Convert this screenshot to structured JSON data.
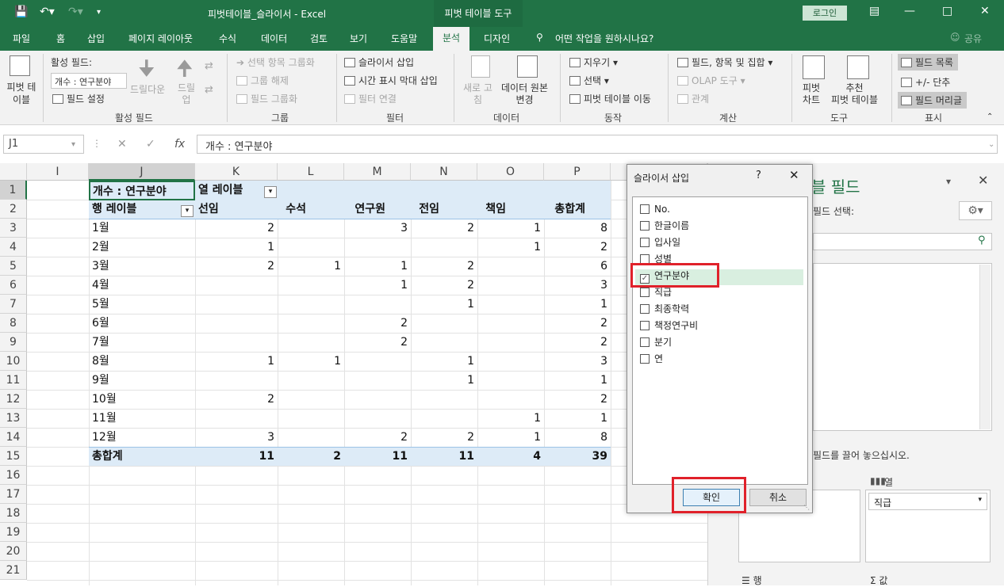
{
  "titlebar": {
    "title": "피벗테이블_슬라이서  -  Excel",
    "context_tab": "피벗 테이블 도구",
    "login": "로그인"
  },
  "tabs": {
    "file": "파일",
    "home": "홈",
    "insert": "삽입",
    "layout": "페이지 레이아웃",
    "formulas": "수식",
    "data": "데이터",
    "review": "검토",
    "view": "보기",
    "help": "도움말",
    "analyze": "분석",
    "design": "디자인",
    "tellme": "어떤 작업을 원하시나요?",
    "share": "공유"
  },
  "ribbon": {
    "pivot_table_btn": "피벗 테\n이블",
    "active_field_label": "활성 필드:",
    "active_field_value": "개수 : 연구분야",
    "field_settings": "필드 설정",
    "drill_down": "드릴다운",
    "drill_up": "드릴\n업",
    "group_active_field": "활성 필드",
    "group_selection": "선택 항목 그룹화",
    "ungroup": "그룹 해제",
    "group_field": "필드 그룹화",
    "group_group": "그룹",
    "insert_slicer": "슬라이서 삽입",
    "insert_timeline": "시간 표시 막대 삽입",
    "filter_connections": "필터 연결",
    "group_filter": "필터",
    "refresh": "새로 고\n침",
    "change_source": "데이터 원본\n변경",
    "group_data": "데이터",
    "clear": "지우기",
    "select": "선택",
    "move_pivot": "피벗 테이블 이동",
    "group_actions": "동작",
    "fields_items_sets": "필드, 항목 및 집합",
    "olap_tools": "OLAP 도구",
    "relationships": "관계",
    "group_calc": "계산",
    "pivot_chart": "피벗\n차트",
    "recommended": "추천\n피벗 테이블",
    "group_tools": "도구",
    "field_list": "필드 목록",
    "buttons": "+/- 단추",
    "field_headers": "필드 머리글",
    "group_show": "표시"
  },
  "formula_bar": {
    "name_box": "J1",
    "formula": "개수 : 연구분야"
  },
  "grid": {
    "columns": [
      "I",
      "J",
      "K",
      "L",
      "M",
      "N",
      "O",
      "P"
    ],
    "rows": [
      "1",
      "2",
      "3",
      "4",
      "5",
      "6",
      "7",
      "8",
      "9",
      "10",
      "11",
      "12",
      "13",
      "14",
      "15",
      "16",
      "17",
      "18",
      "19",
      "20",
      "21"
    ],
    "header_row1": {
      "j": "개수 : 연구분야",
      "k": "열 레이블"
    },
    "header_row2": {
      "j": "행 레이블",
      "k": "선임",
      "l": "수석",
      "m": "연구원",
      "n": "전임",
      "o": "책임",
      "p": "총합계"
    },
    "data_rows": [
      {
        "label": "1월",
        "k": "2",
        "l": "",
        "m": "3",
        "n": "2",
        "o": "1",
        "p": "8"
      },
      {
        "label": "2월",
        "k": "1",
        "l": "",
        "m": "",
        "n": "",
        "o": "1",
        "p": "2"
      },
      {
        "label": "3월",
        "k": "2",
        "l": "1",
        "m": "1",
        "n": "2",
        "o": "",
        "p": "6"
      },
      {
        "label": "4월",
        "k": "",
        "l": "",
        "m": "1",
        "n": "2",
        "o": "",
        "p": "3"
      },
      {
        "label": "5월",
        "k": "",
        "l": "",
        "m": "",
        "n": "1",
        "o": "",
        "p": "1"
      },
      {
        "label": "6월",
        "k": "",
        "l": "",
        "m": "2",
        "n": "",
        "o": "",
        "p": "2"
      },
      {
        "label": "7월",
        "k": "",
        "l": "",
        "m": "2",
        "n": "",
        "o": "",
        "p": "2"
      },
      {
        "label": "8월",
        "k": "1",
        "l": "1",
        "m": "",
        "n": "1",
        "o": "",
        "p": "3"
      },
      {
        "label": "9월",
        "k": "",
        "l": "",
        "m": "",
        "n": "1",
        "o": "",
        "p": "1"
      },
      {
        "label": "10월",
        "k": "2",
        "l": "",
        "m": "",
        "n": "",
        "o": "",
        "p": "2"
      },
      {
        "label": "11월",
        "k": "",
        "l": "",
        "m": "",
        "n": "",
        "o": "1",
        "p": "1"
      },
      {
        "label": "12월",
        "k": "3",
        "l": "",
        "m": "2",
        "n": "2",
        "o": "1",
        "p": "8"
      }
    ],
    "total_row": {
      "label": "총합계",
      "k": "11",
      "l": "2",
      "m": "11",
      "n": "11",
      "o": "4",
      "p": "39"
    }
  },
  "dialog": {
    "title": "슬라이서 삽입",
    "help": "?",
    "fields": [
      {
        "label": "No.",
        "checked": false
      },
      {
        "label": "한글이름",
        "checked": false
      },
      {
        "label": "입사일",
        "checked": false
      },
      {
        "label": "성별",
        "checked": false
      },
      {
        "label": "연구분야",
        "checked": true
      },
      {
        "label": "직급",
        "checked": false
      },
      {
        "label": "최종학력",
        "checked": false
      },
      {
        "label": "책정연구비",
        "checked": false
      },
      {
        "label": "분기",
        "checked": false
      },
      {
        "label": "연",
        "checked": false
      }
    ],
    "ok": "확인",
    "cancel": "취소"
  },
  "pane": {
    "title_partial": "블 필드",
    "choose_fields_partial": "필드 선택:",
    "drag_hint_partial": "필드를 끌어 놓으십시오.",
    "columns_label": "열",
    "column_field": "직급",
    "rows_label": "행",
    "values_label": "값"
  },
  "colors": {
    "excel_green": "#217346",
    "pivot_header_fill": "#ddebf7",
    "highlight_red": "#e0212a"
  }
}
